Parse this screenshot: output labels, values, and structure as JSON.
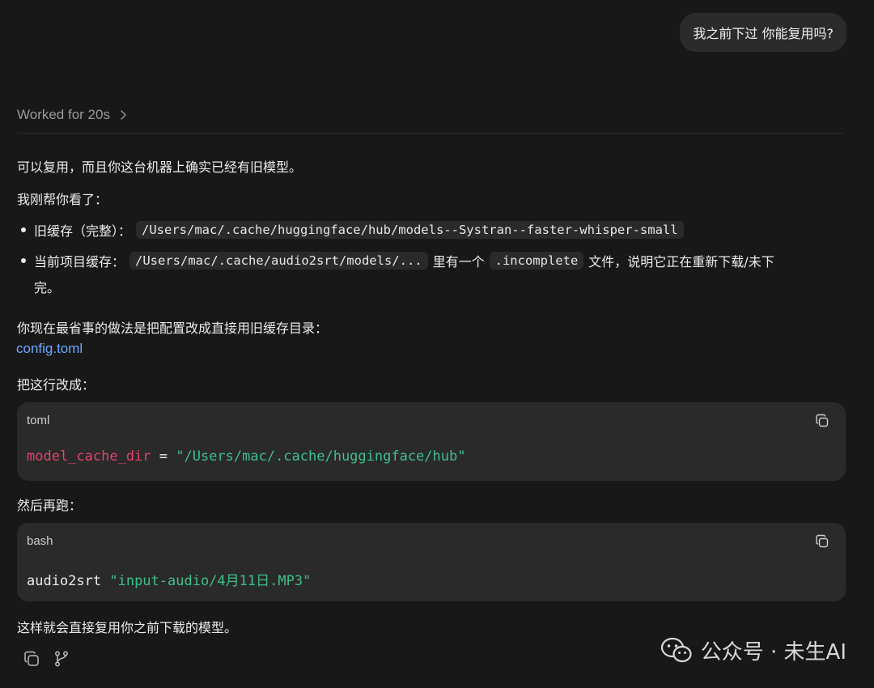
{
  "user_message": "我之前下过 你能复用吗?",
  "worked": {
    "label": "Worked for 20s"
  },
  "answer": {
    "intro": "可以复用，而且你这台机器上确实已经有旧模型。",
    "checked": "我刚帮你看了：",
    "bullets": [
      {
        "label": "旧缓存（完整）：",
        "code": "/Users/mac/.cache/huggingface/hub/models--Systran--faster-whisper-small"
      },
      {
        "label": "当前项目缓存：",
        "code": "/Users/mac/.cache/audio2srt/models/...",
        "mid": "里有一个",
        "code2": ".incomplete",
        "tail": "文件，说明它正在重新下载/未下",
        "tail2": "完。"
      }
    ],
    "suggestion": "你现在最省事的做法是把配置改成直接用旧缓存目录：",
    "config_link": "config.toml",
    "change_line": "把这行改成：",
    "toml_block": {
      "lang": "toml",
      "key": "model_cache_dir",
      "op": " = ",
      "value": "\"/Users/mac/.cache/huggingface/hub\""
    },
    "then_run": "然后再跑：",
    "bash_block": {
      "lang": "bash",
      "cmd": "audio2srt ",
      "arg": "\"input-audio/4月11日.MP3\""
    },
    "conclusion": "这样就会直接复用你之前下载的模型。"
  },
  "watermark": {
    "text": "公众号 · 未生AI",
    "icon": "wechat-icon"
  },
  "icons": {
    "copy": "copy-icon",
    "branch": "branch-icon",
    "chevron": "chevron-right-icon"
  }
}
